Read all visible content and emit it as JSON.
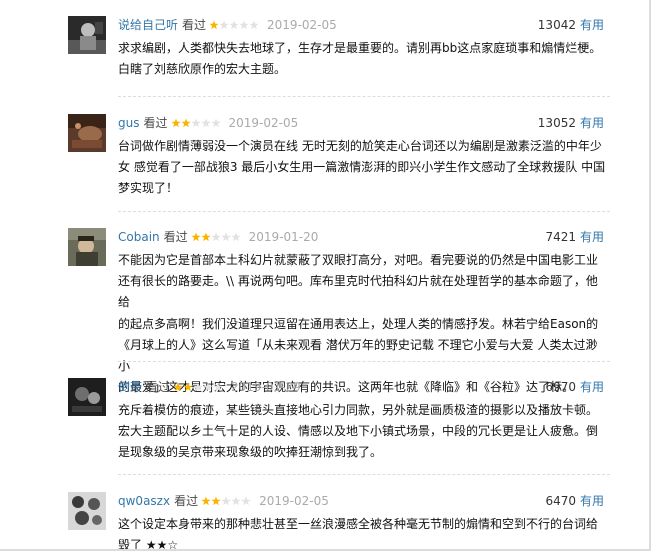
{
  "comments": [
    {
      "user": "说给自己听",
      "status": "看过",
      "rating": 1,
      "date": "2019-02-05",
      "votes": "13042",
      "vote_label": "有用",
      "text": "求求编剧，人类都快失去地球了，生存才是最重要的。请别再bb这点家庭琐事和煽情烂梗。\n白瞎了刘慈欣原作的宏大主题。"
    },
    {
      "user": "gus",
      "status": "看过",
      "rating": 2,
      "date": "2019-02-05",
      "votes": "13052",
      "vote_label": "有用",
      "text": "台词做作剧情薄弱没一个演员在线 无时无刻的尬笑走心台词还以为编剧是激素泛滥的中年少\n女 感觉看了一部战狼3 最后小女生用一篇激情澎湃的即兴小学生作文感动了全球救援队 中国\n梦实现了！"
    },
    {
      "user": "Cobain",
      "status": "看过",
      "rating": 2,
      "date": "2019-01-20",
      "votes": "7421",
      "vote_label": "有用",
      "text": "不能因为它是首部本土科幻片就蒙蔽了双眼打高分，对吧。看完要说的仍然是中国电影工业\n还有很长的路要走。\\\\ 再说两句吧。库布里克时代拍科幻片就在处理哲学的基本命题了，他给\n的起点多高啊！我们没道理只逗留在通用表达上，处理人类的情感抒发。林若宁给Eason的\n《月球上的人》这么写道「从未来观看 潜伏万年的野史记载 不理它小爱与大爱 人类太过渺小\n的最爱」这才是对宏大的宇宙观应有的共识。这两年也就《降临》和《谷粒》达了标。"
    },
    {
      "user": "倒带",
      "status": "看过",
      "rating": 2,
      "date": "2019-01-29",
      "votes": "6970",
      "vote_label": "有用",
      "text": "充斥着模仿的痕迹，某些镜头直接地心引力同款，另外就是画质极渣的摄影以及播放卡顿。\n宏大主题配以乡土气十足的人设、情感以及地下小镇式场景，中段的冗长更是让人疲惫。倒\n是现象级的吴京带来现象级的吹捧狂潮惊到我了。"
    },
    {
      "user": "qw0aszx",
      "status": "看过",
      "rating": 2,
      "date": "2019-02-05",
      "votes": "6470",
      "vote_label": "有用",
      "text": "这个设定本身带来的那种悲壮甚至一丝浪漫感全被各种毫无节制的煽情和空到不行的台词给\n毁了 ★★☆"
    }
  ]
}
